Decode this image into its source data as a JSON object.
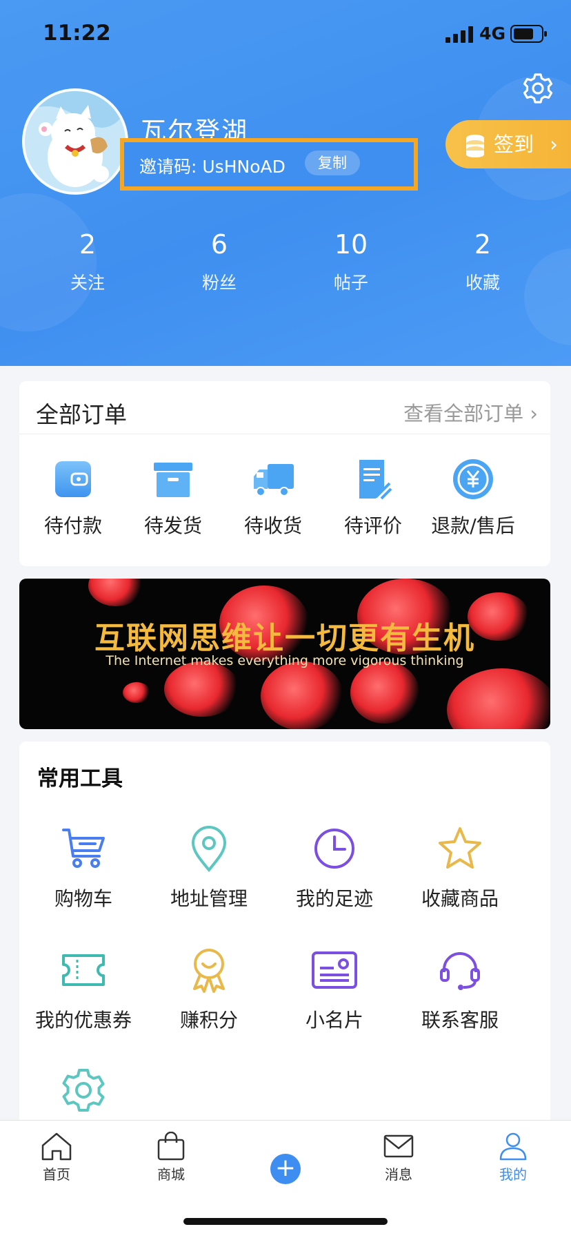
{
  "status_bar": {
    "time": "11:22",
    "network": "4G"
  },
  "profile": {
    "username": "瓦尔登湖",
    "invite_label": "邀请码: UsHNoAD",
    "copy_label": "复制",
    "signin_label": "签到"
  },
  "stats": [
    {
      "value": "2",
      "label": "关注"
    },
    {
      "value": "6",
      "label": "粉丝"
    },
    {
      "value": "10",
      "label": "帖子"
    },
    {
      "value": "2",
      "label": "收藏"
    }
  ],
  "orders": {
    "title": "全部订单",
    "view_all": "查看全部订单",
    "items": [
      {
        "label": "待付款",
        "icon": "wallet-icon"
      },
      {
        "label": "待发货",
        "icon": "box-icon"
      },
      {
        "label": "待收货",
        "icon": "truck-icon"
      },
      {
        "label": "待评价",
        "icon": "review-icon"
      },
      {
        "label": "退款/售后",
        "icon": "refund-icon"
      }
    ]
  },
  "banner": {
    "title": "互联网思维让一切更有生机",
    "subtitle": "The Internet makes everything more vigorous thinking"
  },
  "tools": {
    "title": "常用工具",
    "items": [
      {
        "label": "购物车",
        "icon": "cart-icon"
      },
      {
        "label": "地址管理",
        "icon": "location-icon"
      },
      {
        "label": "我的足迹",
        "icon": "clock-icon"
      },
      {
        "label": "收藏商品",
        "icon": "star-icon"
      },
      {
        "label": "我的优惠券",
        "icon": "coupon-icon"
      },
      {
        "label": "赚积分",
        "icon": "medal-icon"
      },
      {
        "label": "小名片",
        "icon": "card-icon"
      },
      {
        "label": "联系客服",
        "icon": "headset-icon"
      },
      {
        "label": "",
        "icon": "gear-icon"
      }
    ]
  },
  "tabbar": {
    "items": [
      {
        "label": "首页",
        "icon": "home-icon"
      },
      {
        "label": "商城",
        "icon": "bag-icon"
      },
      {
        "label": "",
        "icon": "plus-icon"
      },
      {
        "label": "消息",
        "icon": "mail-icon"
      },
      {
        "label": "我的",
        "icon": "user-icon"
      }
    ],
    "active": "我的"
  },
  "colors": {
    "header_blue": "#3f8ff0",
    "accent_orange": "#f5a623",
    "active_tab": "#3d8ef0",
    "icon_blue": "#4aa3f0",
    "tool_blue": "#4a7ef0",
    "tool_teal": "#5cc6c0",
    "tool_purple": "#7b4fe0",
    "tool_gold": "#e8b84a"
  }
}
